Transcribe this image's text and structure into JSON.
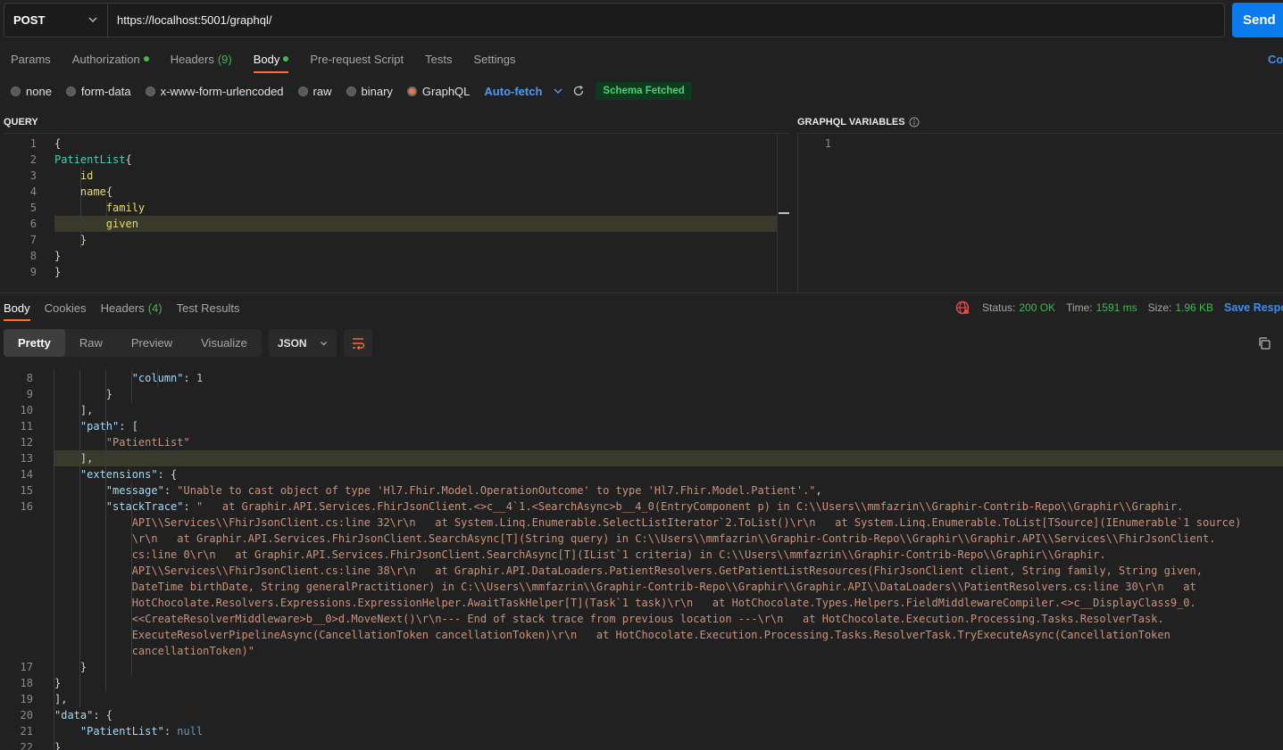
{
  "request": {
    "method": "POST",
    "url": "https://localhost:5001/graphql/",
    "send_label": "Send"
  },
  "request_tabs": [
    {
      "label": "Params"
    },
    {
      "label": "Authorization",
      "dot": true
    },
    {
      "label": "Headers",
      "count": "(9)"
    },
    {
      "label": "Body",
      "dot": true,
      "active": true
    },
    {
      "label": "Pre-request Script"
    },
    {
      "label": "Tests"
    },
    {
      "label": "Settings"
    }
  ],
  "cookies_link": "Co",
  "body_types": {
    "options": [
      "none",
      "form-data",
      "x-www-form-urlencoded",
      "raw",
      "binary",
      "GraphQL"
    ],
    "selected": "GraphQL",
    "auto_fetch": "Auto-fetch",
    "schema_badge": "Schema Fetched"
  },
  "query_label": "QUERY",
  "variables_label": "GRAPHQL VARIABLES",
  "query_lines": [
    {
      "n": "1",
      "text": "{"
    },
    {
      "n": "2",
      "text": "PatientList{"
    },
    {
      "n": "3",
      "text": "    id"
    },
    {
      "n": "4",
      "text": "    name{"
    },
    {
      "n": "5",
      "text": "        family"
    },
    {
      "n": "6",
      "text": "        given"
    },
    {
      "n": "7",
      "text": "    }"
    },
    {
      "n": "8",
      "text": "}"
    },
    {
      "n": "9",
      "text": "}"
    }
  ],
  "variables_lines": [
    {
      "n": "1",
      "text": ""
    }
  ],
  "response_tabs": [
    {
      "label": "Body",
      "active": true
    },
    {
      "label": "Cookies"
    },
    {
      "label": "Headers",
      "count": "(4)"
    },
    {
      "label": "Test Results"
    }
  ],
  "status": {
    "status_label": "Status:",
    "status_value": "200 OK",
    "time_label": "Time:",
    "time_value": "1591 ms",
    "size_label": "Size:",
    "size_value": "1.96 KB",
    "save_label": "Save Respo"
  },
  "view_modes": [
    "Pretty",
    "Raw",
    "Preview",
    "Visualize"
  ],
  "format": "JSON",
  "response_lines": [
    {
      "n": "8",
      "text": "            \"column\": 1"
    },
    {
      "n": "9",
      "text": "        }"
    },
    {
      "n": "10",
      "text": "    ],"
    },
    {
      "n": "11",
      "text": "    \"path\": ["
    },
    {
      "n": "12",
      "text": "        \"PatientList\""
    },
    {
      "n": "13",
      "text": "    ],"
    },
    {
      "n": "14",
      "text": "    \"extensions\": {"
    },
    {
      "n": "15",
      "text": "        \"message\": \"Unable to cast object of type 'Hl7.Fhir.Model.OperationOutcome' to type 'Hl7.Fhir.Model.Patient'.\","
    },
    {
      "n": "16",
      "text": "        \"stackTrace\": \"   at Graphir.API.Services.FhirJsonClient.<>c__4`1.<SearchAsync>b__4_0(EntryComponent p) in C:\\\\Users\\\\mmfazrin\\\\Graphir-Contrib-Repo\\\\Graphir\\\\Graphir."
    },
    {
      "n": "",
      "text": "            API\\\\Services\\\\FhirJsonClient.cs:line 32\\r\\n   at System.Linq.Enumerable.SelectListIterator`2.ToList()\\r\\n   at System.Linq.Enumerable.ToList[TSource](IEnumerable`1 source)"
    },
    {
      "n": "",
      "text": "            \\r\\n   at Graphir.API.Services.FhirJsonClient.SearchAsync[T](String query) in C:\\\\Users\\\\mmfazrin\\\\Graphir-Contrib-Repo\\\\Graphir\\\\Graphir.API\\\\Services\\\\FhirJsonClient."
    },
    {
      "n": "",
      "text": "            cs:line 0\\r\\n   at Graphir.API.Services.FhirJsonClient.SearchAsync[T](IList`1 criteria) in C:\\\\Users\\\\mmfazrin\\\\Graphir-Contrib-Repo\\\\Graphir\\\\Graphir."
    },
    {
      "n": "",
      "text": "            API\\\\Services\\\\FhirJsonClient.cs:line 38\\r\\n   at Graphir.API.DataLoaders.PatientResolvers.GetPatientListResources(FhirJsonClient client, String family, String given,"
    },
    {
      "n": "",
      "text": "            DateTime birthDate, String generalPractitioner) in C:\\\\Users\\\\mmfazrin\\\\Graphir-Contrib-Repo\\\\Graphir\\\\Graphir.API\\\\DataLoaders\\\\PatientResolvers.cs:line 30\\r\\n   at"
    },
    {
      "n": "",
      "text": "            HotChocolate.Resolvers.Expressions.ExpressionHelper.AwaitTaskHelper[T](Task`1 task)\\r\\n   at HotChocolate.Types.Helpers.FieldMiddlewareCompiler.<>c__DisplayClass9_0."
    },
    {
      "n": "",
      "text": "            <<CreateResolverMiddleware>b__0>d.MoveNext()\\r\\n--- End of stack trace from previous location ---\\r\\n   at HotChocolate.Execution.Processing.Tasks.ResolverTask."
    },
    {
      "n": "",
      "text": "            ExecuteResolverPipelineAsync(CancellationToken cancellationToken)\\r\\n   at HotChocolate.Execution.Processing.Tasks.ResolverTask.TryExecuteAsync(CancellationToken"
    },
    {
      "n": "",
      "text": "            cancellationToken)\""
    },
    {
      "n": "17",
      "text": "    }"
    },
    {
      "n": "18",
      "text": "}"
    },
    {
      "n": "19",
      "text": "],"
    },
    {
      "n": "20",
      "text": "\"data\": {"
    },
    {
      "n": "21",
      "text": "    \"PatientList\": null"
    },
    {
      "n": "22",
      "text": "}"
    }
  ],
  "colors": {
    "accent_orange": "#ff6c37",
    "send_blue": "#097bed",
    "success_green": "#3fb950"
  }
}
